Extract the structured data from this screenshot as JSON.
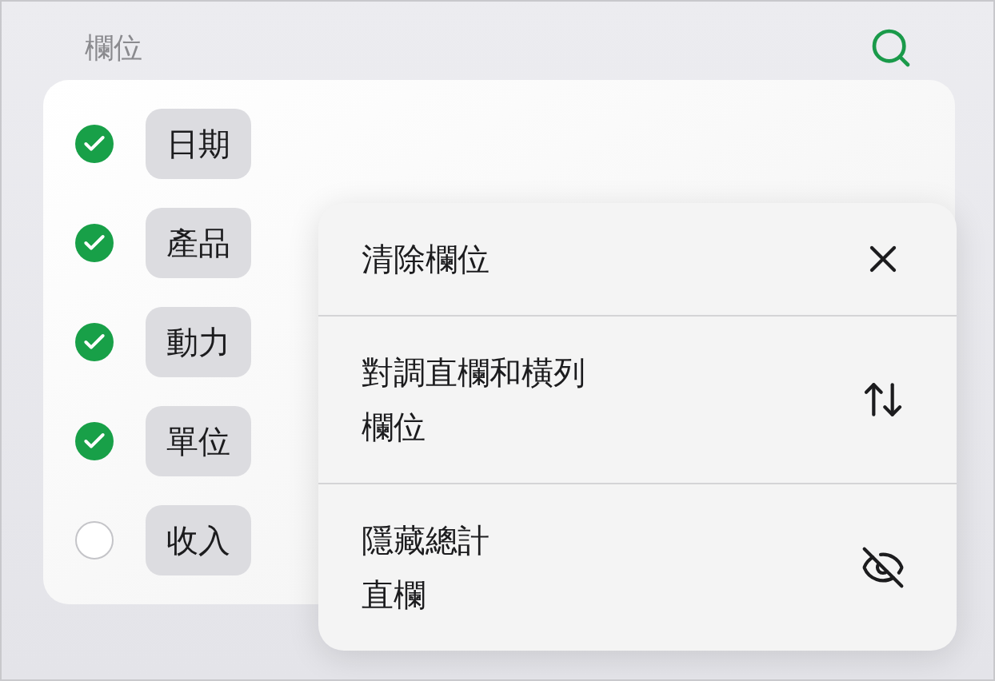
{
  "header": {
    "title": "欄位"
  },
  "fields": [
    {
      "label": "日期",
      "checked": true
    },
    {
      "label": "產品",
      "checked": true
    },
    {
      "label": "動力",
      "checked": true
    },
    {
      "label": "單位",
      "checked": true
    },
    {
      "label": "收入",
      "checked": false
    }
  ],
  "menu": [
    {
      "kind": "clear",
      "label": "清除欄位"
    },
    {
      "kind": "swap",
      "label": "對調直欄和橫列欄位"
    },
    {
      "kind": "hide",
      "label": "隱藏總計直欄"
    }
  ]
}
